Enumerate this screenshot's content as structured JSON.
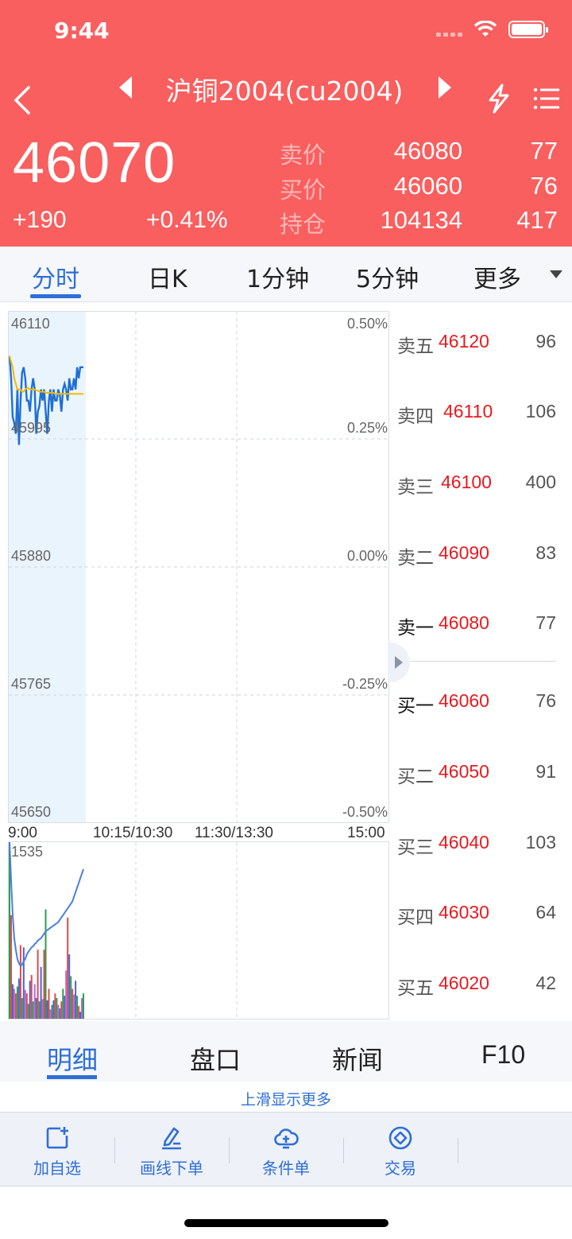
{
  "status_bar": {
    "time": "9:44"
  },
  "header": {
    "title": "沪铜2004(cu2004)",
    "last_price": "46070",
    "change": "+190",
    "change_pct": "+0.41%",
    "quotes": [
      {
        "label": "卖价",
        "value": "46080",
        "volume": "77"
      },
      {
        "label": "买价",
        "value": "46060",
        "volume": "76"
      },
      {
        "label": "持仓",
        "value": "104134",
        "volume": "417"
      }
    ]
  },
  "period_tabs": [
    "分时",
    "日K",
    "1分钟",
    "5分钟",
    "更多"
  ],
  "chart": {
    "price_axis": [
      "46110",
      "45995",
      "45880",
      "45765",
      "45650"
    ],
    "pct_axis": [
      "0.50%",
      "0.25%",
      "0.00%",
      "-0.25%",
      "-0.50%"
    ],
    "time_axis": [
      "9:00",
      "10:15/10:30",
      "11:30/13:30",
      "15:00"
    ],
    "volume_max_label": "1535"
  },
  "chart_data": {
    "type": "line",
    "title": "",
    "xlabel": "",
    "ylabel": "",
    "ylim": [
      45650,
      46110
    ],
    "x": [
      0,
      1,
      2,
      3,
      4,
      5,
      6,
      7,
      8,
      9,
      10,
      11,
      12,
      13,
      14,
      15,
      16,
      17,
      18,
      19,
      20,
      21,
      22,
      23,
      24,
      25,
      26,
      27,
      28,
      29,
      30,
      31,
      32,
      33,
      34,
      35,
      36,
      37,
      38,
      39,
      40,
      41,
      42,
      43,
      44,
      45,
      46,
      47
    ],
    "series": [
      {
        "values": [
          46070,
          46050,
          46015,
          46010,
          46000,
          46040,
          45990,
          46030,
          46055,
          46060,
          46050,
          46030,
          46030,
          46020,
          46040,
          46050,
          46040,
          46000,
          46020,
          46025,
          46040,
          46030,
          46040,
          46020,
          46000,
          46030,
          46040,
          46020,
          46040,
          46030,
          46030,
          46040,
          46035,
          46020,
          46040,
          46045,
          46040,
          46030,
          46050,
          46040,
          46040,
          46050,
          46040,
          46060,
          46050,
          46060,
          46060,
          46060
        ]
      },
      {
        "values": [
          46070,
          46065,
          46060,
          46050,
          46045,
          46040,
          46040,
          46040,
          46038,
          46038,
          46040,
          46041,
          46041,
          46040,
          46040,
          46040,
          46040,
          46039,
          46039,
          46038,
          46038,
          46038,
          46038,
          46037,
          46037,
          46037,
          46037,
          46037,
          46037,
          46036,
          46036,
          46036,
          46036,
          46036,
          46036,
          46036,
          46036,
          46036,
          46036,
          46036,
          46036,
          46036,
          46036,
          46036,
          46036,
          46036,
          46036,
          46036
        ]
      }
    ],
    "volume_ylim": [
      0,
      1535
    ],
    "volume": [
      1535,
      900,
      300,
      260,
      220,
      280,
      350,
      640,
      180,
      620,
      250,
      220,
      130,
      330,
      380,
      150,
      300,
      180,
      600,
      150,
      450,
      170,
      600,
      950,
      160,
      260,
      80,
      120,
      160,
      220,
      180,
      120,
      90,
      150,
      260,
      200,
      420,
      880,
      560,
      370,
      260,
      210,
      330,
      200,
      110,
      60,
      180,
      220
    ],
    "volume_colors": [
      "#2e9e4f",
      "#e24a4a",
      "#4a64d8",
      "#b569d6",
      "#e24a4a",
      "#2e9e4f",
      "#4a64d8",
      "#e24a4a",
      "#2e9e4f",
      "#4a64d8",
      "#b569d6",
      "#e24a4a",
      "#2e9e4f",
      "#4a64d8",
      "#e24a4a",
      "#2e9e4f",
      "#b569d6",
      "#4a64d8",
      "#e24a4a",
      "#2e9e4f",
      "#4a64d8",
      "#b569d6",
      "#e24a4a",
      "#2e9e4f",
      "#4a64d8",
      "#e24a4a",
      "#b569d6",
      "#2e9e4f",
      "#4a64d8",
      "#e24a4a",
      "#2e9e4f",
      "#b569d6",
      "#4a64d8",
      "#e24a4a",
      "#2e9e4f",
      "#4a64d8",
      "#b569d6",
      "#e24a4a",
      "#4a64d8",
      "#2e9e4f",
      "#e24a4a",
      "#b569d6",
      "#4a64d8",
      "#2e9e4f",
      "#e24a4a",
      "#4a64d8",
      "#b569d6",
      "#2e9e4f"
    ],
    "volume_avg": [
      1535,
      1200,
      900,
      700,
      600,
      520,
      480,
      460,
      470,
      500,
      520,
      560,
      580,
      600,
      620,
      630,
      650,
      660,
      680,
      690,
      700,
      720,
      740,
      760,
      770,
      780,
      790,
      800,
      810,
      820,
      830,
      840,
      860,
      880,
      900,
      920,
      940,
      960,
      980,
      1000,
      1020,
      1060,
      1100,
      1140,
      1180,
      1220,
      1260,
      1300
    ]
  },
  "order_book": [
    {
      "name": "卖五",
      "price": "46120",
      "qty": "96"
    },
    {
      "name": "卖四",
      "price": "46110",
      "qty": "106"
    },
    {
      "name": "卖三",
      "price": "46100",
      "qty": "400"
    },
    {
      "name": "卖二",
      "price": "46090",
      "qty": "83"
    },
    {
      "name": "卖一",
      "price": "46080",
      "qty": "77"
    },
    {
      "name": "买一",
      "price": "46060",
      "qty": "76"
    },
    {
      "name": "买二",
      "price": "46050",
      "qty": "91"
    },
    {
      "name": "买三",
      "price": "46040",
      "qty": "103"
    },
    {
      "name": "买四",
      "price": "46030",
      "qty": "64"
    },
    {
      "name": "买五",
      "price": "46020",
      "qty": "42"
    }
  ],
  "bottom_tabs": [
    "明细",
    "盘口",
    "新闻",
    "F10"
  ],
  "hint": "上滑显示更多",
  "toolbar": [
    {
      "label": "加自选",
      "icon": "add-watchlist-icon"
    },
    {
      "label": "画线下单",
      "icon": "draw-order-icon"
    },
    {
      "label": "条件单",
      "icon": "cloud-condition-icon"
    },
    {
      "label": "交易",
      "icon": "trade-icon"
    }
  ],
  "colors": {
    "header": "#f95f5f",
    "accent": "#2f6fd6",
    "ask_bid": "#e8191f",
    "price_line": "#1f6fd6",
    "avg_line": "#f5b800"
  }
}
